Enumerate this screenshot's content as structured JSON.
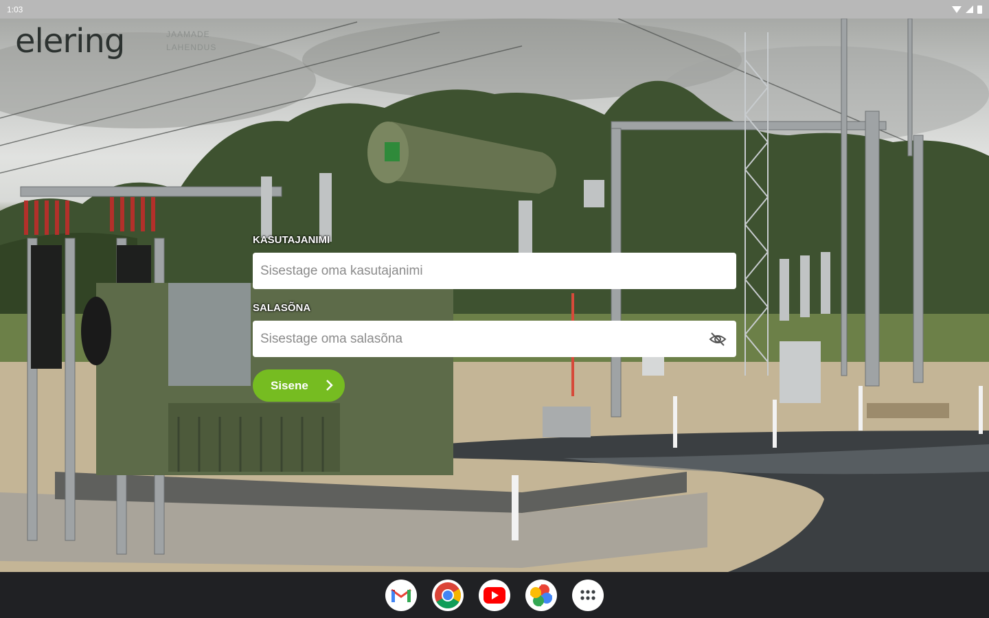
{
  "status_bar": {
    "time": "1:03"
  },
  "brand": {
    "logo_text": "elering",
    "subtitle_line1": "JAAMADE",
    "subtitle_line2": "LAHENDUS"
  },
  "login": {
    "username_label": "KASUTAJANIMI",
    "username_placeholder": "Sisestage oma kasutajanimi",
    "password_label": "SALASÕNA",
    "password_placeholder": "Sisestage oma salasõna",
    "submit_label": "Sisene",
    "accent_color": "#76bc21"
  },
  "dock": {
    "apps": [
      {
        "name": "Gmail",
        "icon": "gmail-icon"
      },
      {
        "name": "Chrome",
        "icon": "chrome-icon"
      },
      {
        "name": "YouTube",
        "icon": "youtube-icon"
      },
      {
        "name": "Photos",
        "icon": "photos-icon"
      },
      {
        "name": "App drawer",
        "icon": "apps-grid-icon"
      }
    ]
  }
}
